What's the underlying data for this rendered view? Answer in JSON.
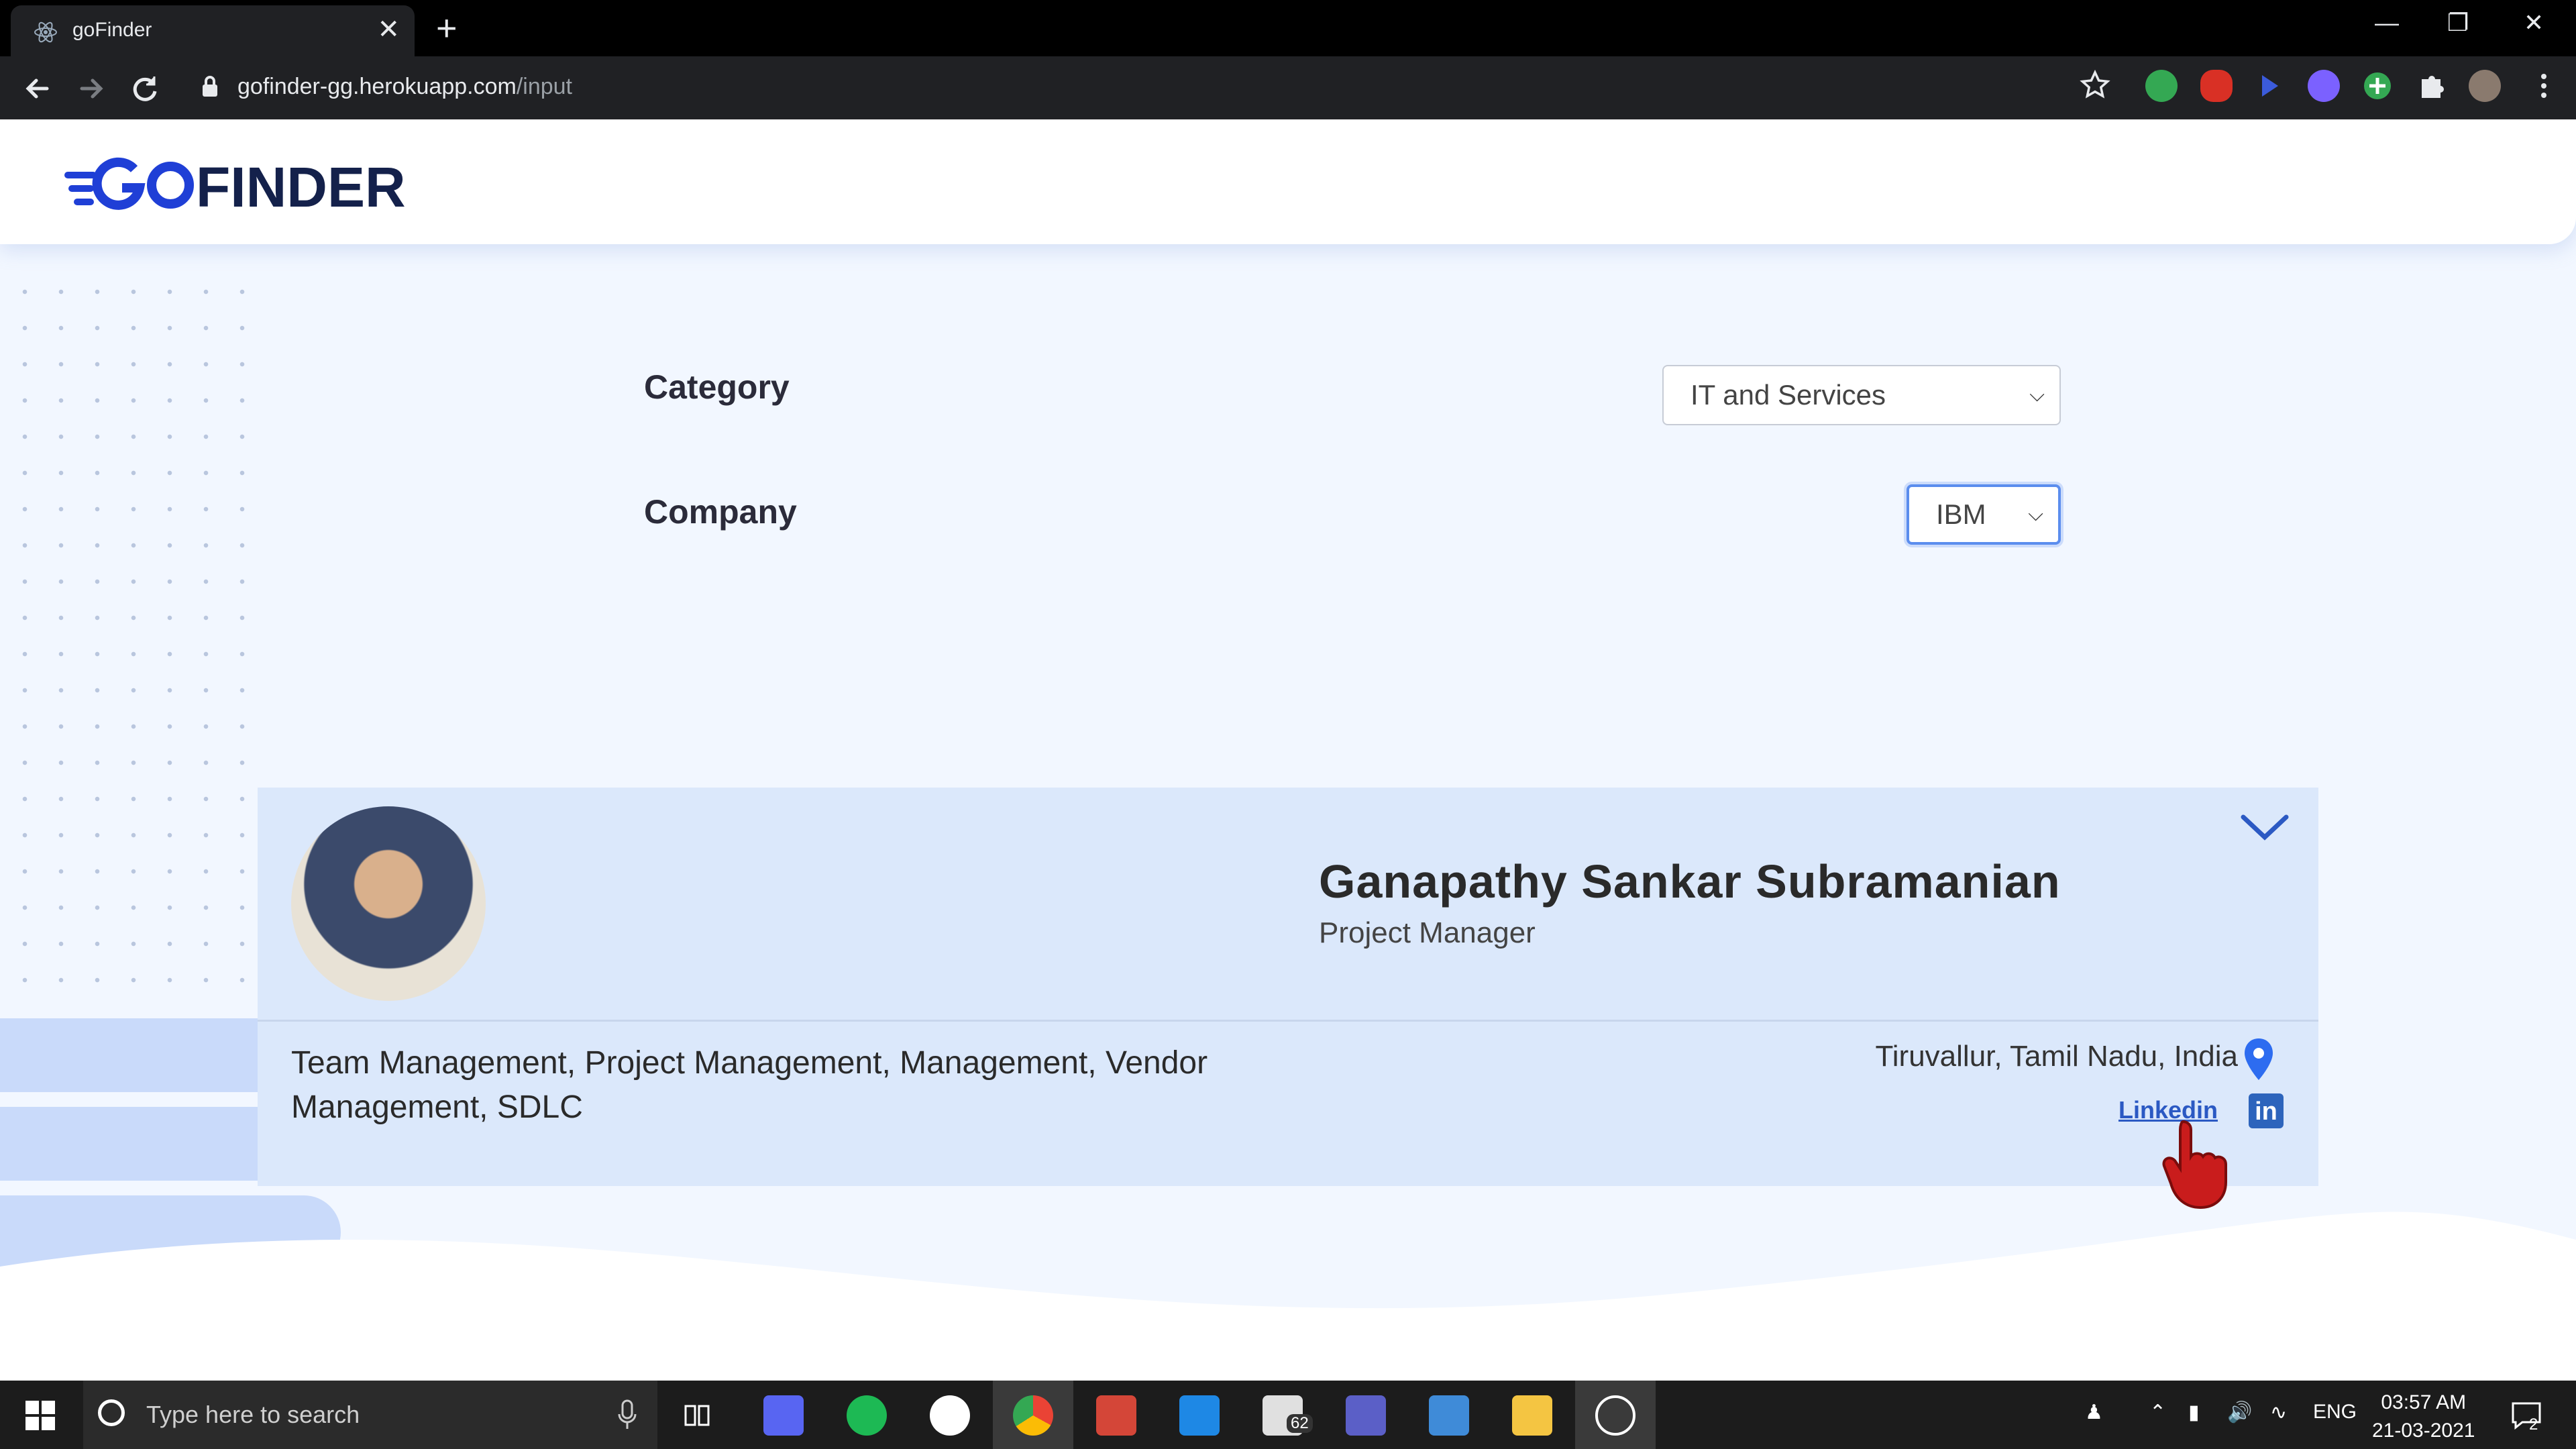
{
  "browser": {
    "tab_title": "goFinder",
    "url_host": "gofinder-gg.herokuapp.com",
    "url_path": "/input"
  },
  "site": {
    "logo_text": "GOFINDER",
    "brand_color": "#1f3fd6"
  },
  "form": {
    "category_label": "Category",
    "category_value": "IT and Services",
    "company_label": "Company",
    "company_value": "IBM"
  },
  "result": {
    "name": "Ganapathy Sankar Subramanian",
    "role": "Project Manager",
    "skills": "Team Management, Project Management, Management, Vendor Management, SDLC",
    "location": "Tiruvallur, Tamil Nadu, India",
    "linkedin_label": "Linkedin",
    "linkedin_icon_text": "in"
  },
  "taskbar": {
    "search_placeholder": "Type here to search",
    "mail_badge": "62",
    "language": "ENG",
    "time": "03:57 AM",
    "date": "21-03-2021",
    "notifications": "2"
  }
}
